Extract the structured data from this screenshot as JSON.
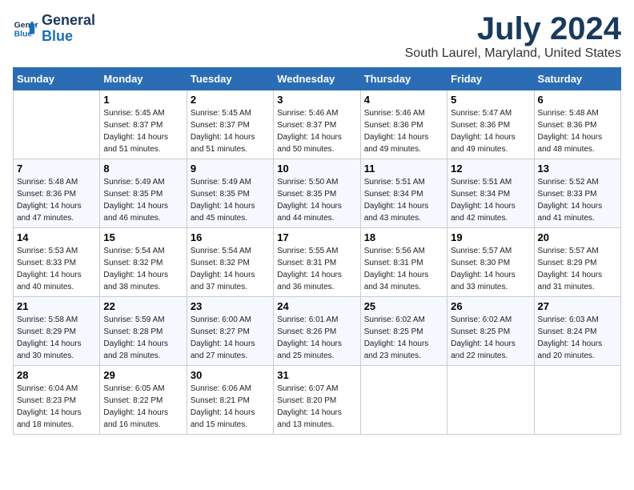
{
  "header": {
    "logo_line1": "General",
    "logo_line2": "Blue",
    "month": "July 2024",
    "location": "South Laurel, Maryland, United States"
  },
  "weekdays": [
    "Sunday",
    "Monday",
    "Tuesday",
    "Wednesday",
    "Thursday",
    "Friday",
    "Saturday"
  ],
  "weeks": [
    [
      {
        "day": "",
        "info": ""
      },
      {
        "day": "1",
        "info": "Sunrise: 5:45 AM\nSunset: 8:37 PM\nDaylight: 14 hours\nand 51 minutes."
      },
      {
        "day": "2",
        "info": "Sunrise: 5:45 AM\nSunset: 8:37 PM\nDaylight: 14 hours\nand 51 minutes."
      },
      {
        "day": "3",
        "info": "Sunrise: 5:46 AM\nSunset: 8:37 PM\nDaylight: 14 hours\nand 50 minutes."
      },
      {
        "day": "4",
        "info": "Sunrise: 5:46 AM\nSunset: 8:36 PM\nDaylight: 14 hours\nand 49 minutes."
      },
      {
        "day": "5",
        "info": "Sunrise: 5:47 AM\nSunset: 8:36 PM\nDaylight: 14 hours\nand 49 minutes."
      },
      {
        "day": "6",
        "info": "Sunrise: 5:48 AM\nSunset: 8:36 PM\nDaylight: 14 hours\nand 48 minutes."
      }
    ],
    [
      {
        "day": "7",
        "info": "Sunrise: 5:48 AM\nSunset: 8:36 PM\nDaylight: 14 hours\nand 47 minutes."
      },
      {
        "day": "8",
        "info": "Sunrise: 5:49 AM\nSunset: 8:35 PM\nDaylight: 14 hours\nand 46 minutes."
      },
      {
        "day": "9",
        "info": "Sunrise: 5:49 AM\nSunset: 8:35 PM\nDaylight: 14 hours\nand 45 minutes."
      },
      {
        "day": "10",
        "info": "Sunrise: 5:50 AM\nSunset: 8:35 PM\nDaylight: 14 hours\nand 44 minutes."
      },
      {
        "day": "11",
        "info": "Sunrise: 5:51 AM\nSunset: 8:34 PM\nDaylight: 14 hours\nand 43 minutes."
      },
      {
        "day": "12",
        "info": "Sunrise: 5:51 AM\nSunset: 8:34 PM\nDaylight: 14 hours\nand 42 minutes."
      },
      {
        "day": "13",
        "info": "Sunrise: 5:52 AM\nSunset: 8:33 PM\nDaylight: 14 hours\nand 41 minutes."
      }
    ],
    [
      {
        "day": "14",
        "info": "Sunrise: 5:53 AM\nSunset: 8:33 PM\nDaylight: 14 hours\nand 40 minutes."
      },
      {
        "day": "15",
        "info": "Sunrise: 5:54 AM\nSunset: 8:32 PM\nDaylight: 14 hours\nand 38 minutes."
      },
      {
        "day": "16",
        "info": "Sunrise: 5:54 AM\nSunset: 8:32 PM\nDaylight: 14 hours\nand 37 minutes."
      },
      {
        "day": "17",
        "info": "Sunrise: 5:55 AM\nSunset: 8:31 PM\nDaylight: 14 hours\nand 36 minutes."
      },
      {
        "day": "18",
        "info": "Sunrise: 5:56 AM\nSunset: 8:31 PM\nDaylight: 14 hours\nand 34 minutes."
      },
      {
        "day": "19",
        "info": "Sunrise: 5:57 AM\nSunset: 8:30 PM\nDaylight: 14 hours\nand 33 minutes."
      },
      {
        "day": "20",
        "info": "Sunrise: 5:57 AM\nSunset: 8:29 PM\nDaylight: 14 hours\nand 31 minutes."
      }
    ],
    [
      {
        "day": "21",
        "info": "Sunrise: 5:58 AM\nSunset: 8:29 PM\nDaylight: 14 hours\nand 30 minutes."
      },
      {
        "day": "22",
        "info": "Sunrise: 5:59 AM\nSunset: 8:28 PM\nDaylight: 14 hours\nand 28 minutes."
      },
      {
        "day": "23",
        "info": "Sunrise: 6:00 AM\nSunset: 8:27 PM\nDaylight: 14 hours\nand 27 minutes."
      },
      {
        "day": "24",
        "info": "Sunrise: 6:01 AM\nSunset: 8:26 PM\nDaylight: 14 hours\nand 25 minutes."
      },
      {
        "day": "25",
        "info": "Sunrise: 6:02 AM\nSunset: 8:25 PM\nDaylight: 14 hours\nand 23 minutes."
      },
      {
        "day": "26",
        "info": "Sunrise: 6:02 AM\nSunset: 8:25 PM\nDaylight: 14 hours\nand 22 minutes."
      },
      {
        "day": "27",
        "info": "Sunrise: 6:03 AM\nSunset: 8:24 PM\nDaylight: 14 hours\nand 20 minutes."
      }
    ],
    [
      {
        "day": "28",
        "info": "Sunrise: 6:04 AM\nSunset: 8:23 PM\nDaylight: 14 hours\nand 18 minutes."
      },
      {
        "day": "29",
        "info": "Sunrise: 6:05 AM\nSunset: 8:22 PM\nDaylight: 14 hours\nand 16 minutes."
      },
      {
        "day": "30",
        "info": "Sunrise: 6:06 AM\nSunset: 8:21 PM\nDaylight: 14 hours\nand 15 minutes."
      },
      {
        "day": "31",
        "info": "Sunrise: 6:07 AM\nSunset: 8:20 PM\nDaylight: 14 hours\nand 13 minutes."
      },
      {
        "day": "",
        "info": ""
      },
      {
        "day": "",
        "info": ""
      },
      {
        "day": "",
        "info": ""
      }
    ]
  ]
}
